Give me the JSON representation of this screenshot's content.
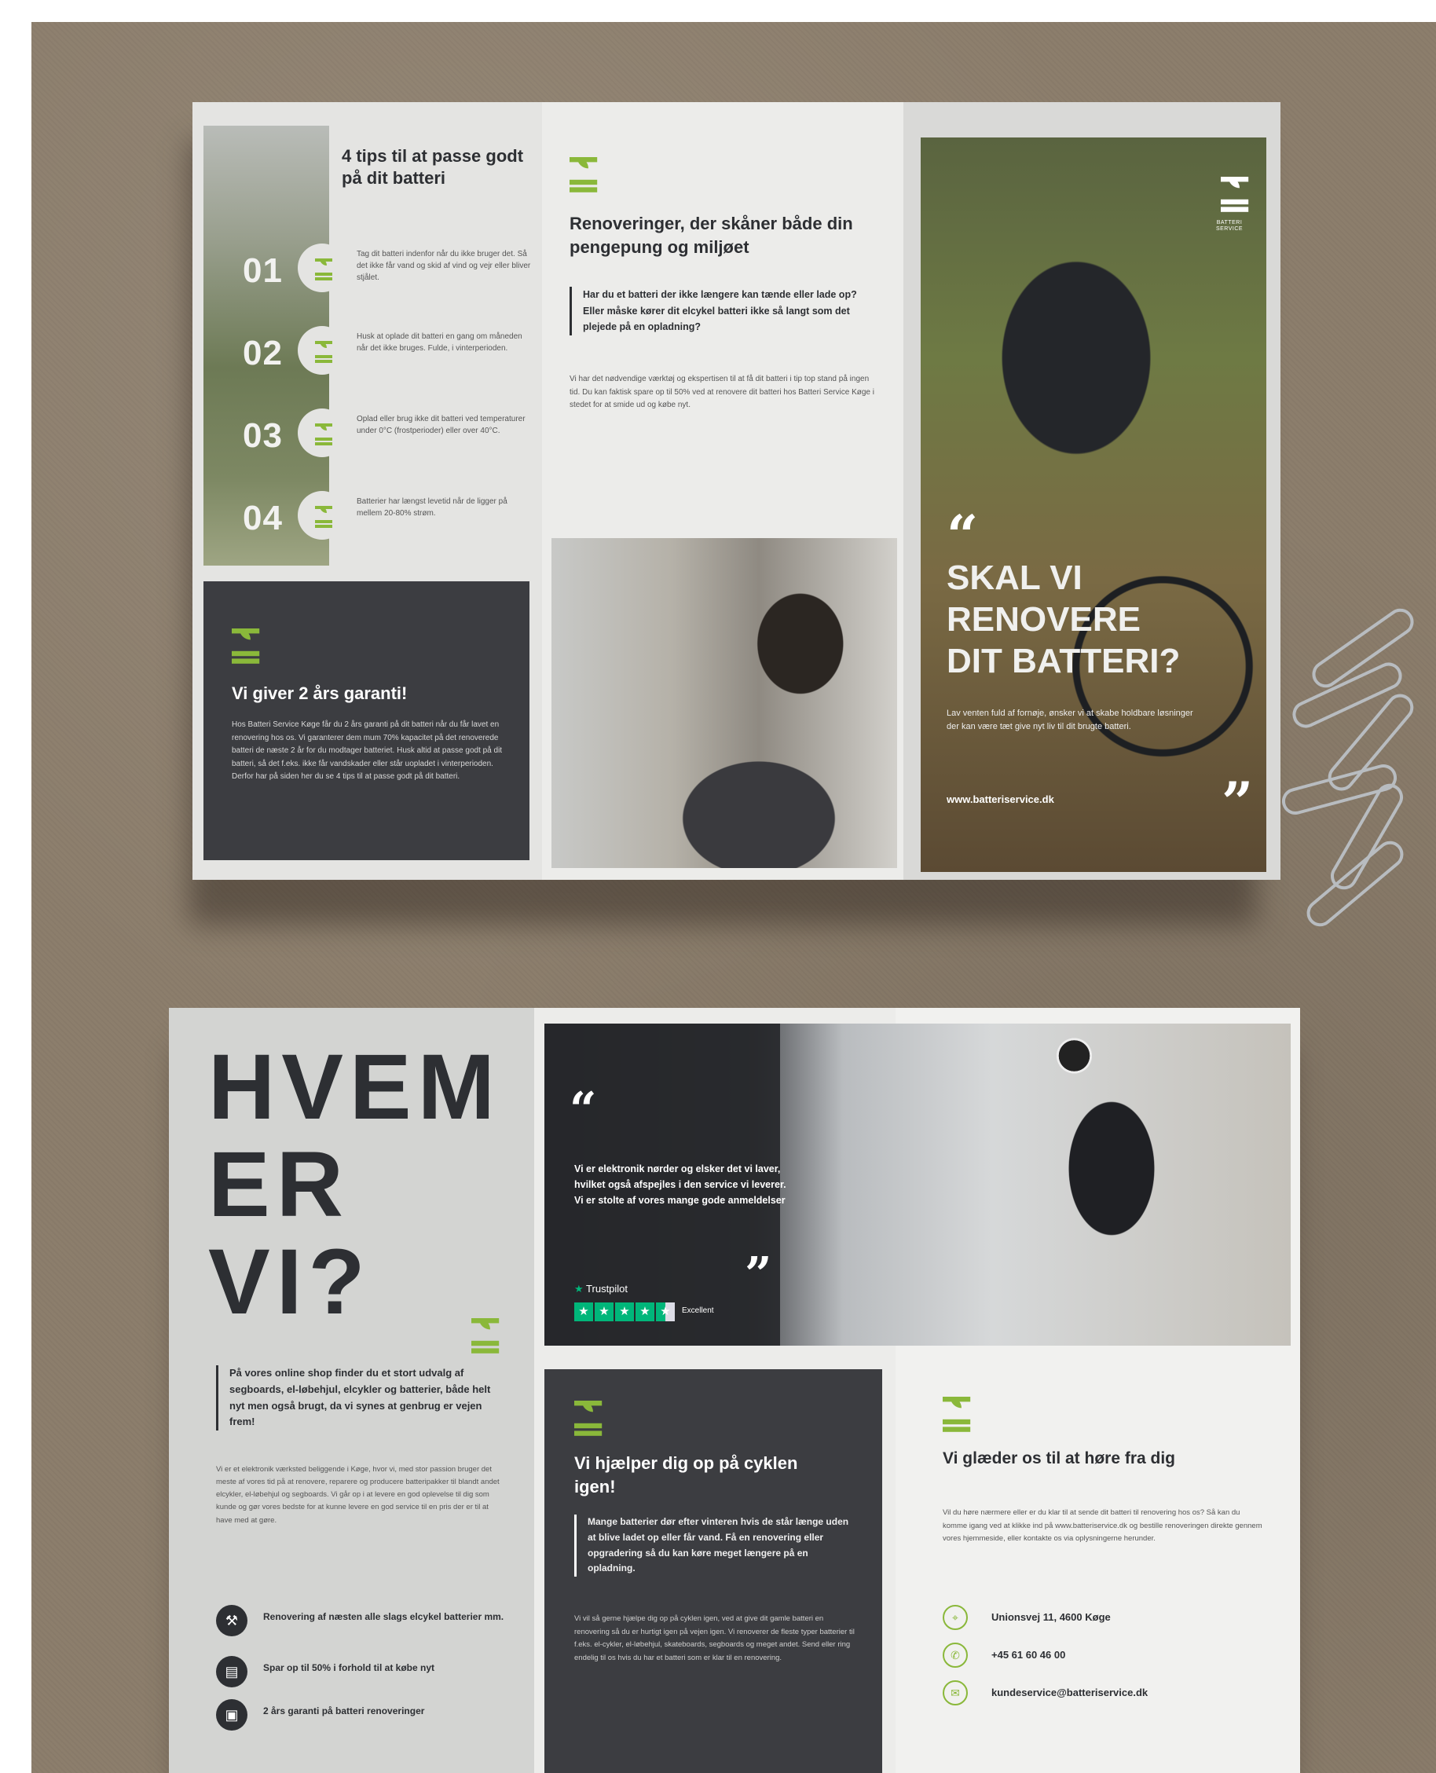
{
  "top": {
    "tips": {
      "title": "4 tips til at passe godt på dit batteri",
      "items": [
        {
          "num": "01",
          "text": "Tag dit batteri indenfor når du ikke bruger det. Så det ikke får vand og skid af vind og vejr eller bliver stjålet."
        },
        {
          "num": "02",
          "text": "Husk at oplade dit batteri en gang om måneden når det ikke bruges. Fulde, i vinterperioden."
        },
        {
          "num": "03",
          "text": "Oplad eller brug ikke dit batteri ved temperaturer under 0°C (frostperioder) eller over 40°C."
        },
        {
          "num": "04",
          "text": "Batterier har længst levetid når de ligger på mellem 20-80% strøm."
        }
      ]
    },
    "guarantee": {
      "title": "Vi giver 2 års garanti!",
      "body": "Hos Batteri Service Køge får du 2 års garanti på dit batteri når du får lavet en renovering hos os. Vi garanterer dem mum 70% kapacitet på det renoverede batteri de næste 2 år for du modtager batteriet. Husk altid at passe godt på dit batteri, så det f.eks. ikke får vandskader eller står uopladet i vinterperioden. Derfor har på siden her du se 4 tips til at passe godt på dit batteri."
    },
    "renovation": {
      "title": "Renoveringer, der skåner både din pengepung og miljøet",
      "lead": "Har du et batteri der ikke længere kan tænde eller lade op? Eller måske kører dit elcykel batteri ikke så langt som det plejede på en opladning?",
      "body": "Vi har det nødvendige værktøj og ekspertisen til at få dit batteri i tip top stand på ingen tid. Du kan faktisk spare op til 50% ved at renovere dit batteri hos Batteri Service Køge i stedet for at smide ud og købe nyt."
    },
    "cover": {
      "quote_open": "“",
      "headline_lines": [
        "SKAL VI",
        "RENOVERE",
        "DIT BATTERI?"
      ],
      "sub": "Lav venten fuld af fornøje, ønsker vi at skabe holdbare løsninger der kan være tæt give nyt liv til dit brugte batteri.",
      "url": "www.batteriservice.dk",
      "quote_close": "”",
      "logo_word": "BATTERI SERVICE"
    }
  },
  "bottom": {
    "intro": {
      "headline_lines": [
        "HVEM",
        "ER",
        "VI?"
      ],
      "lead": "På vores online shop finder du et stort udvalg af segboards, el-løbehjul, elcykler og batterier, både helt nyt men også brugt, da vi synes at genbrug er vejen frem!",
      "body": "Vi er et elektronik værksted beliggende i Køge, hvor vi, med stor passion bruger det meste af vores tid på at renovere, reparere og producere batteripakker til blandt andet elcykler, el-løbehjul og segboards. Vi går op i at levere en god oplevelse til dig som kunde og gør vores bedste for at kunne levere en god service til en pris der er til at have med at gøre.",
      "features": [
        {
          "icon": "wrench-icon",
          "glyph": "⚒",
          "text": "Renovering af næsten alle slags elcykel batterier mm."
        },
        {
          "icon": "wallet-icon",
          "glyph": "▤",
          "text": "Spar op til 50% i forhold til at købe nyt"
        },
        {
          "icon": "shield-icon",
          "glyph": "▣",
          "text": "2 års garanti på batteri renoveringer"
        }
      ]
    },
    "review": {
      "quote_open": "“",
      "text": "Vi er elektronik nørder og elsker det vi laver, hvilket også afspejles i den service vi leverer. Vi er stolte af vores mange gode anmeldelser",
      "quote_close": "”",
      "trustpilot_label": "Trustpilot",
      "rating_stars": 4.5,
      "rating_text": "Excellent"
    },
    "help": {
      "title": "Vi hjælper dig op på cyklen igen!",
      "lead": "Mange batterier dør efter vinteren hvis de står længe uden at blive ladet op eller får vand. Få en renovering eller opgradering så du kan køre meget længere på en opladning.",
      "body": "Vi vil så gerne hjælpe dig op på cyklen igen, ved at give dit gamle batteri en renovering så du er hurtigt igen på vejen igen. Vi renoverer de fleste typer batterier til f.eks. el-cykler, el-løbehjul, skateboards, segboards og meget andet. Send eller ring endelig til os hvis du har et batteri som er klar til en renovering."
    },
    "contact": {
      "title": "Vi glæder os til at høre fra dig",
      "body": "Vil du høre nærmere eller er du klar til at sende dit batteri til renovering hos os? Så kan du komme igang ved at klikke ind på www.batteriservice.dk og bestille renoveringen direkte gennem vores hjemmeside, eller kontakte os via oplysningerne herunder.",
      "rows": [
        {
          "icon": "location-icon",
          "glyph": "⌖",
          "text": "Unionsvej 11, 4600 Køge"
        },
        {
          "icon": "phone-icon",
          "glyph": "✆",
          "text": "+45 61 60 46 00"
        },
        {
          "icon": "email-icon",
          "glyph": "✉",
          "text": "kundeservice@batteriservice.dk"
        }
      ]
    }
  },
  "colors": {
    "accent_green": "#8ab83a",
    "dark_panel": "#3c3d41",
    "trustpilot_green": "#00b67a"
  }
}
